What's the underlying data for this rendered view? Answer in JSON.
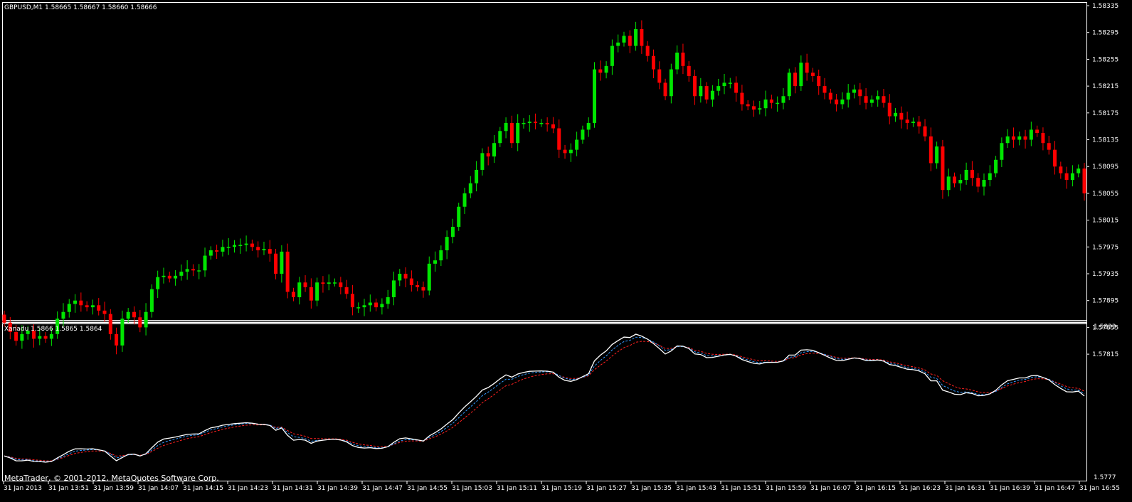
{
  "main_panel": {
    "header": "GBPUSD,M1  1.58665 1.58667 1.58660 1.58666",
    "price_labels": [
      "1.58335",
      "1.58295",
      "1.58255",
      "1.58215",
      "1.58175",
      "1.58135",
      "1.58095",
      "1.58055",
      "1.58015",
      "1.57975",
      "1.57935",
      "1.57895",
      "1.57855",
      "1.57815"
    ]
  },
  "indicator_panel": {
    "header": "Xanadu 1.5866 1.5865 1.5864",
    "scale_top": "1.5833",
    "scale_bottom": "1.5777"
  },
  "time_labels": [
    "31 Jan 2013",
    "31 Jan 13:51",
    "31 Jan 13:59",
    "31 Jan 14:07",
    "31 Jan 14:15",
    "31 Jan 14:23",
    "31 Jan 14:31",
    "31 Jan 14:39",
    "31 Jan 14:47",
    "31 Jan 14:55",
    "31 Jan 15:03",
    "31 Jan 15:11",
    "31 Jan 15:19",
    "31 Jan 15:27",
    "31 Jan 15:35",
    "31 Jan 15:43",
    "31 Jan 15:51",
    "31 Jan 15:59",
    "31 Jan 16:07",
    "31 Jan 16:15",
    "31 Jan 16:23",
    "31 Jan 16:31",
    "31 Jan 16:39",
    "31 Jan 16:47",
    "31 Jan 16:55"
  ],
  "copyright": "MetaTrader, © 2001-2012, MetaQuotes Software Corp.",
  "colors": {
    "bull": "#00e600",
    "bear": "#ff0000",
    "background": "#000000",
    "frame": "#ffffff",
    "ma_fast": "#ffffff",
    "ma_mid": "#3399ff",
    "ma_slow": "#ff2020"
  },
  "chart_data": {
    "type": "candlestick",
    "symbol": "GBPUSD",
    "timeframe": "M1",
    "closes": [
      1.57862,
      1.57848,
      1.57835,
      1.57845,
      1.5785,
      1.57838,
      1.57842,
      1.57838,
      1.57845,
      1.57868,
      1.57878,
      1.5789,
      1.57895,
      1.57888,
      1.57885,
      1.57888,
      1.5788,
      1.57875,
      1.57845,
      1.57828,
      1.57868,
      1.57878,
      1.5787,
      1.57855,
      1.57878,
      1.57912,
      1.5793,
      1.57932,
      1.57928,
      1.57932,
      1.57938,
      1.57942,
      1.5794,
      1.5794,
      1.57962,
      1.5797,
      1.57968,
      1.57975,
      1.57975,
      1.57978,
      1.57978,
      1.5798,
      1.57975,
      1.5797,
      1.57972,
      1.57965,
      1.57935,
      1.57968,
      1.57908,
      1.579,
      1.57922,
      1.57915,
      1.57895,
      1.57922,
      1.5792,
      1.57922,
      1.57922,
      1.57915,
      1.57905,
      1.57885,
      1.57885,
      1.57888,
      1.57892,
      1.57885,
      1.5789,
      1.579,
      1.57925,
      1.57935,
      1.57928,
      1.57918,
      1.57915,
      1.5791,
      1.5795,
      1.57955,
      1.5797,
      1.5799,
      1.58005,
      1.58035,
      1.58055,
      1.5807,
      1.5809,
      1.58115,
      1.5811,
      1.5813,
      1.58148,
      1.5816,
      1.5813,
      1.5816,
      1.5816,
      1.58162,
      1.5816,
      1.5816,
      1.58158,
      1.58152,
      1.5812,
      1.58115,
      1.5812,
      1.58135,
      1.5815,
      1.5816,
      1.5824,
      1.58235,
      1.58245,
      1.58275,
      1.5828,
      1.5829,
      1.58275,
      1.583,
      1.58275,
      1.5826,
      1.5824,
      1.5822,
      1.582,
      1.5824,
      1.58265,
      1.58245,
      1.5823,
      1.582,
      1.58215,
      1.58195,
      1.58208,
      1.58215,
      1.5822,
      1.5822,
      1.58205,
      1.58188,
      1.58185,
      1.5818,
      1.58182,
      1.58195,
      1.5819,
      1.5819,
      1.582,
      1.58235,
      1.58215,
      1.5825,
      1.58235,
      1.5823,
      1.58215,
      1.58205,
      1.58195,
      1.58188,
      1.58195,
      1.58205,
      1.5821,
      1.582,
      1.5819,
      1.58195,
      1.582,
      1.5819,
      1.5817,
      1.58175,
      1.58165,
      1.5816,
      1.58162,
      1.58155,
      1.5814,
      1.581,
      1.58125,
      1.5806,
      1.5808,
      1.5807,
      1.58075,
      1.5809,
      1.58078,
      1.58065,
      1.58075,
      1.58085,
      1.58105,
      1.5813,
      1.5814,
      1.58135,
      1.5814,
      1.58135,
      1.5815,
      1.58145,
      1.5813,
      1.5812,
      1.58095,
      1.58085,
      1.58075,
      1.58085,
      1.58092,
      1.58055
    ]
  }
}
